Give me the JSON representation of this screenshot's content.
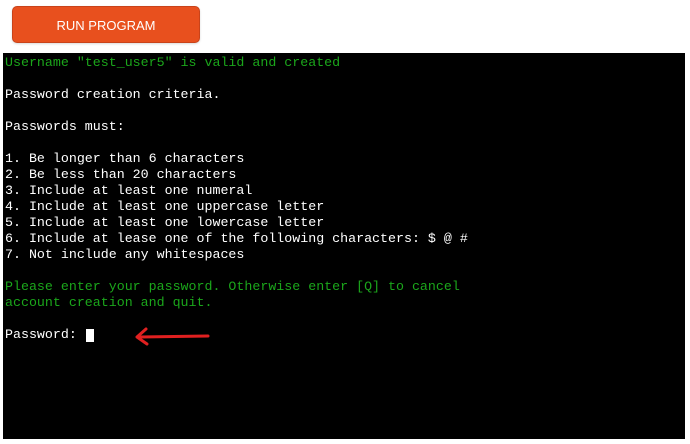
{
  "toolbar": {
    "run_label": "RUN PROGRAM"
  },
  "terminal": {
    "line_username": "Username \"test_user5\" is valid and created",
    "line_criteria": "Password creation criteria.",
    "line_must": "Passwords must:",
    "rules": [
      "1. Be longer than 6 characters",
      "2. Be less than 20 characters",
      "3. Include at least one numeral",
      "4. Include at least one uppercase letter",
      "5. Include at least one lowercase letter",
      "6. Include at lease one of the following characters: $ @ #",
      "7. Not include any whitespaces"
    ],
    "instruction_line1": "Please enter your password. Otherwise enter [Q] to cancel",
    "instruction_line2": "account creation and quit.",
    "prompt": "Password: "
  },
  "colors": {
    "button": "#e8501e",
    "terminal_bg": "#000000",
    "green_text": "#1ba61b",
    "arrow": "#e02020"
  },
  "icons": {
    "annotation": "red-arrow-left-icon"
  }
}
